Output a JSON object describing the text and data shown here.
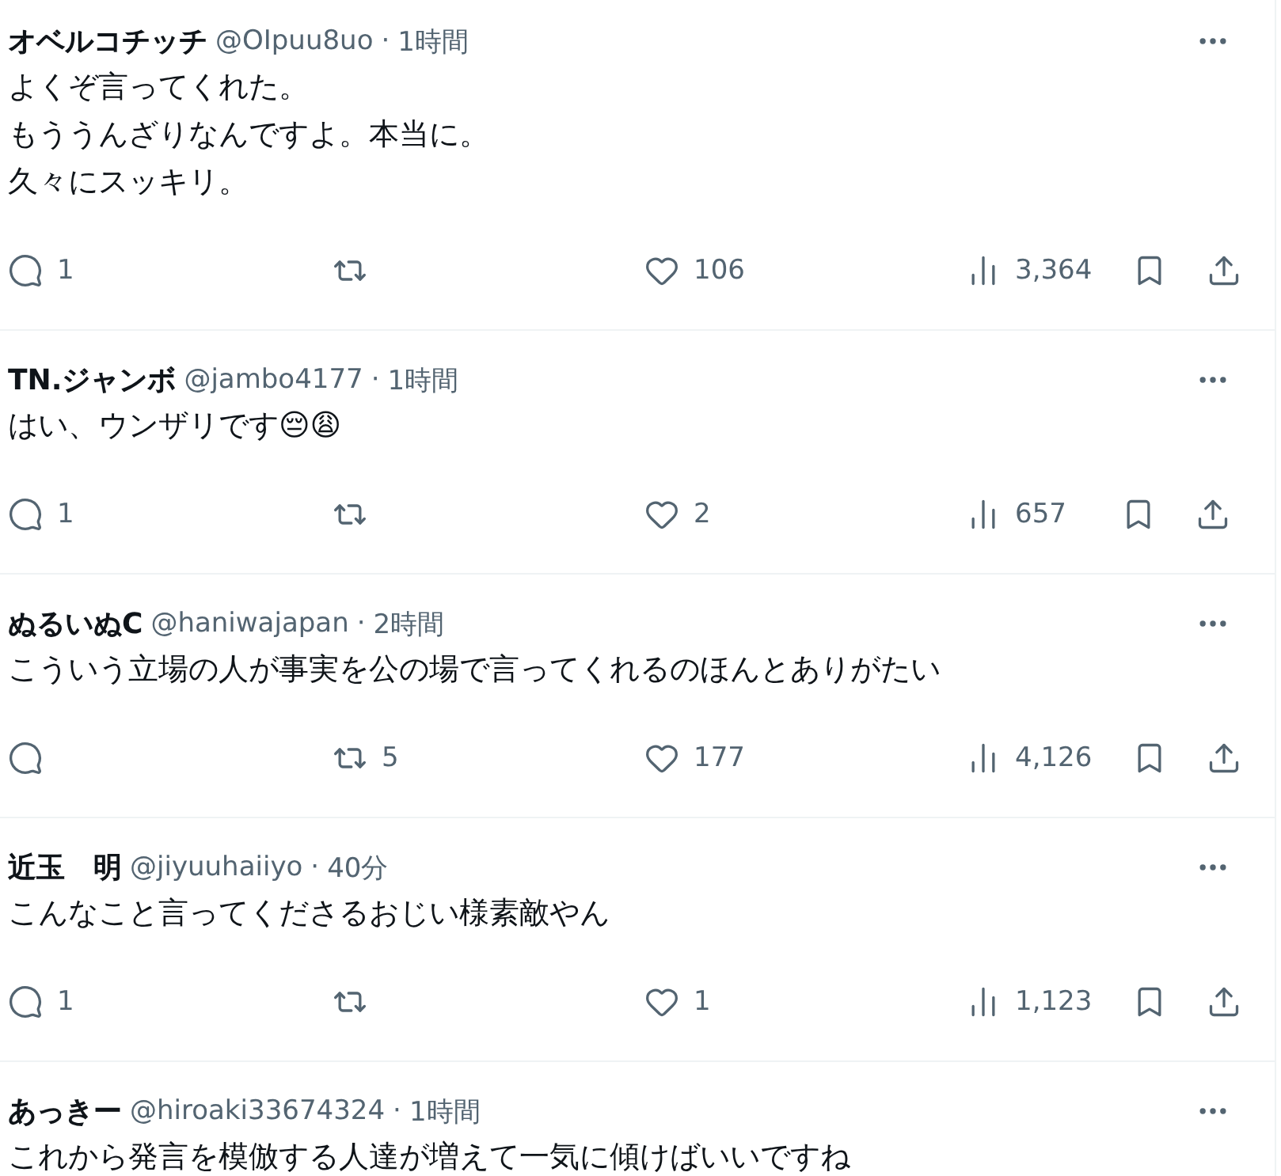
{
  "replies": [
    {
      "name": "オベルコチッチ",
      "handle": "@OIpuu8uo",
      "separator": "·",
      "time": "1時間",
      "lines": [
        "よくぞ言ってくれた。",
        "もううんざりなんですよ。本当に。",
        "久々にスッキリ。"
      ],
      "reply_count": "1",
      "like_count": "106",
      "view_count": "3,364"
    },
    {
      "name": "TN.ジャンボ",
      "handle": "@jambo4177",
      "separator": "·",
      "time": "1時間",
      "lines": [
        "はい、ウンザリです😔😩"
      ],
      "reply_count": "1",
      "like_count": "2",
      "view_count": "657"
    },
    {
      "name": "ぬるいぬC",
      "handle": "@haniwajapan",
      "separator": "·",
      "time": "2時間",
      "lines": [
        "こういう立場の人が事実を公の場で言ってくれるのほんとありがたい"
      ],
      "repost_count": "5",
      "like_count": "177",
      "view_count": "4,126"
    },
    {
      "name": "近玉　明",
      "handle": "@jiyuuhaiiyo",
      "separator": "·",
      "time": "40分",
      "lines": [
        "こんなこと言ってくださるおじい様素敵やん"
      ],
      "reply_count": "1",
      "like_count": "1",
      "view_count": "1,123"
    },
    {
      "name": "あっきー",
      "handle": "@hiroaki33674324",
      "separator": "·",
      "time": "1時間",
      "lines": [
        "これから発言を模倣する人達が増えて一気に傾けばいいですね"
      ]
    }
  ]
}
